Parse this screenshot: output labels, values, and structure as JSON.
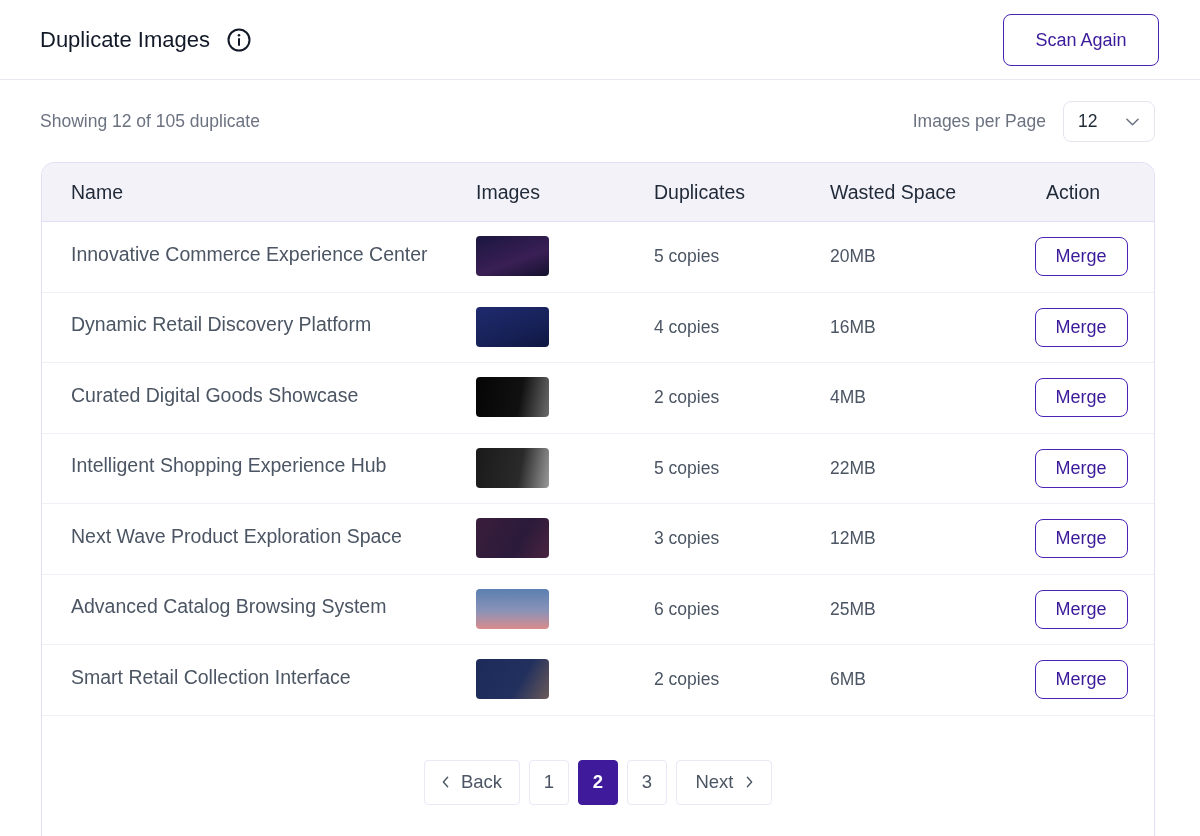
{
  "header": {
    "title": "Duplicate Images",
    "scan_button": "Scan Again"
  },
  "summary": {
    "text": "Showing 12 of 105 duplicate",
    "per_page_label": "Images per Page",
    "per_page_value": "12"
  },
  "table": {
    "columns": [
      "Name",
      "Images",
      "Duplicates",
      "Wasted Space",
      "Action"
    ],
    "rows": [
      {
        "name": "Innovative Commerce Experience Center",
        "duplicates": "5 copies",
        "wasted_space": "20MB",
        "action": "Merge"
      },
      {
        "name": "Dynamic Retail Discovery Platform",
        "duplicates": "4 copies",
        "wasted_space": "16MB",
        "action": "Merge"
      },
      {
        "name": "Curated Digital Goods Showcase",
        "duplicates": "2 copies",
        "wasted_space": "4MB",
        "action": "Merge"
      },
      {
        "name": "Intelligent Shopping Experience Hub",
        "duplicates": "5 copies",
        "wasted_space": "22MB",
        "action": "Merge"
      },
      {
        "name": "Next Wave Product Exploration Space",
        "duplicates": "3 copies",
        "wasted_space": "12MB",
        "action": "Merge"
      },
      {
        "name": "Advanced Catalog Browsing System",
        "duplicates": "6 copies",
        "wasted_space": "25MB",
        "action": "Merge"
      },
      {
        "name": "Smart Retail Collection Interface",
        "duplicates": "2 copies",
        "wasted_space": "6MB",
        "action": "Merge"
      }
    ]
  },
  "pagination": {
    "back": "Back",
    "next": "Next",
    "pages": [
      {
        "label": "1",
        "selected": false
      },
      {
        "label": "2",
        "selected": true
      },
      {
        "label": "3",
        "selected": false
      }
    ]
  }
}
